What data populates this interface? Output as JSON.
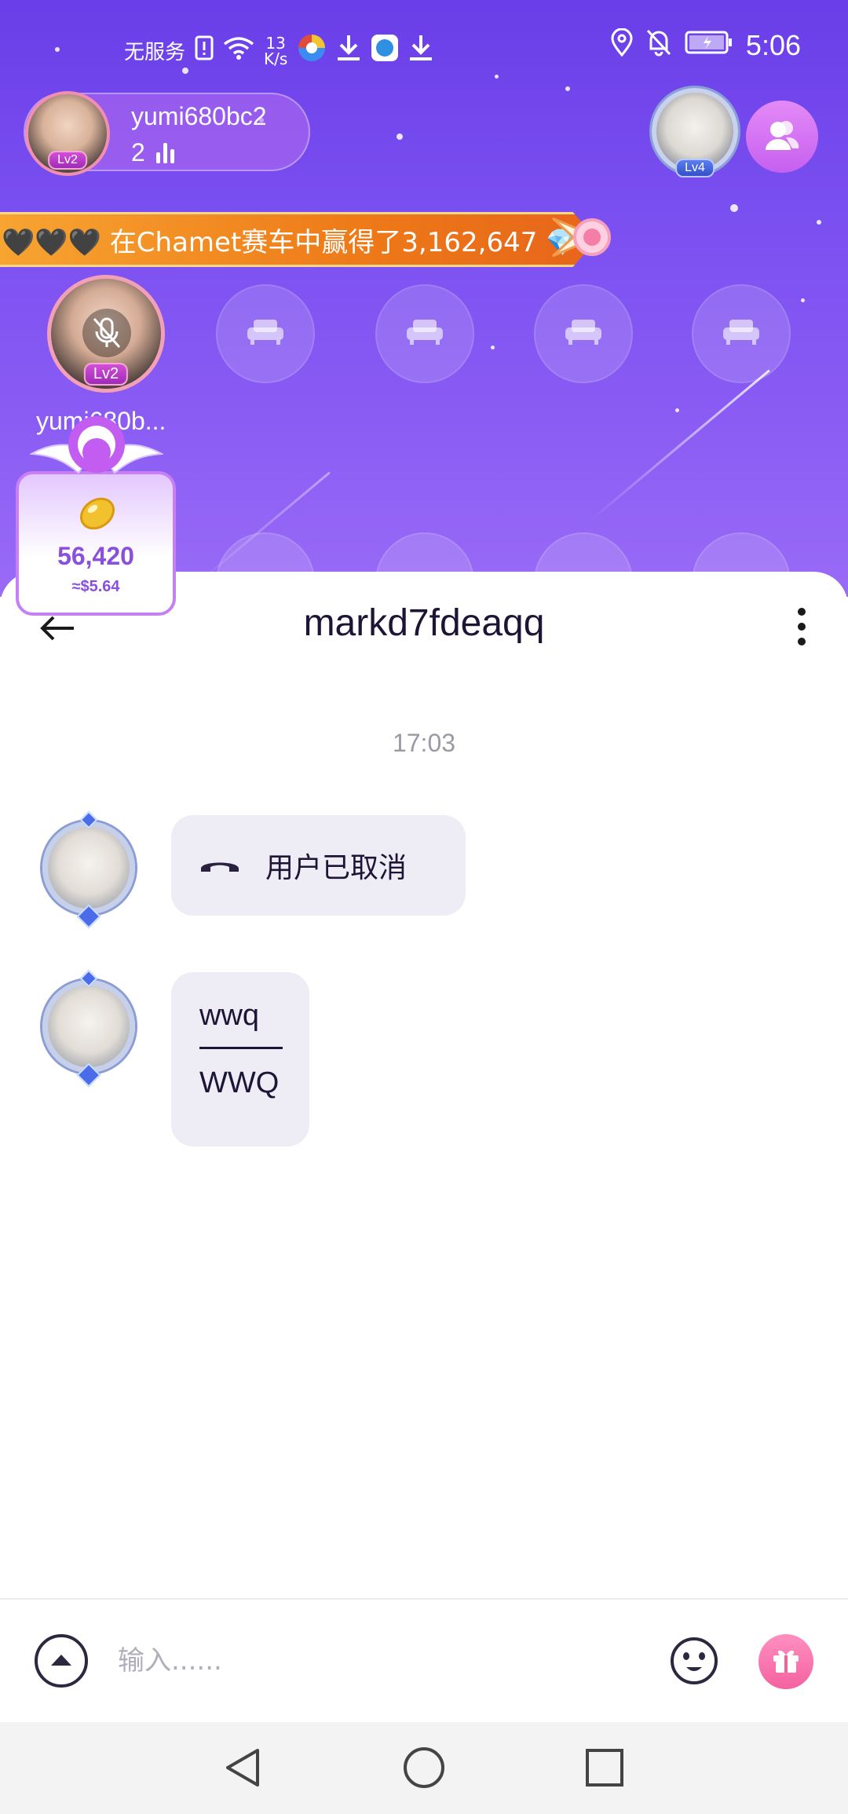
{
  "status_bar": {
    "carrier": "无服务",
    "speed_value": "13",
    "speed_unit": "K/s",
    "time": "5:06"
  },
  "room": {
    "host_name": "yumi680bc2",
    "host_level": "Lv2",
    "listener_count": "2",
    "vip_level": "Lv4",
    "banner_text": "🖤🖤🖤 在Chamet赛车中赢得了3,162,647 💎!",
    "seat_host_level": "Lv2",
    "seat_host_name": "yumi680b...",
    "coin_amount": "56,420",
    "coin_usd": "≈$5.64"
  },
  "chat": {
    "title": "markd7fdeaqq",
    "timestamp": "17:03",
    "call_status": "用户已取消",
    "message_line1": "wwq",
    "message_line2": "WWQ"
  },
  "input": {
    "placeholder": "输入......"
  },
  "colors": {
    "room_bg": "#7a4ff0",
    "accent_purple": "#8a4fdc",
    "banner_orange": "#ee7a18",
    "gift_pink": "#f3629f"
  }
}
